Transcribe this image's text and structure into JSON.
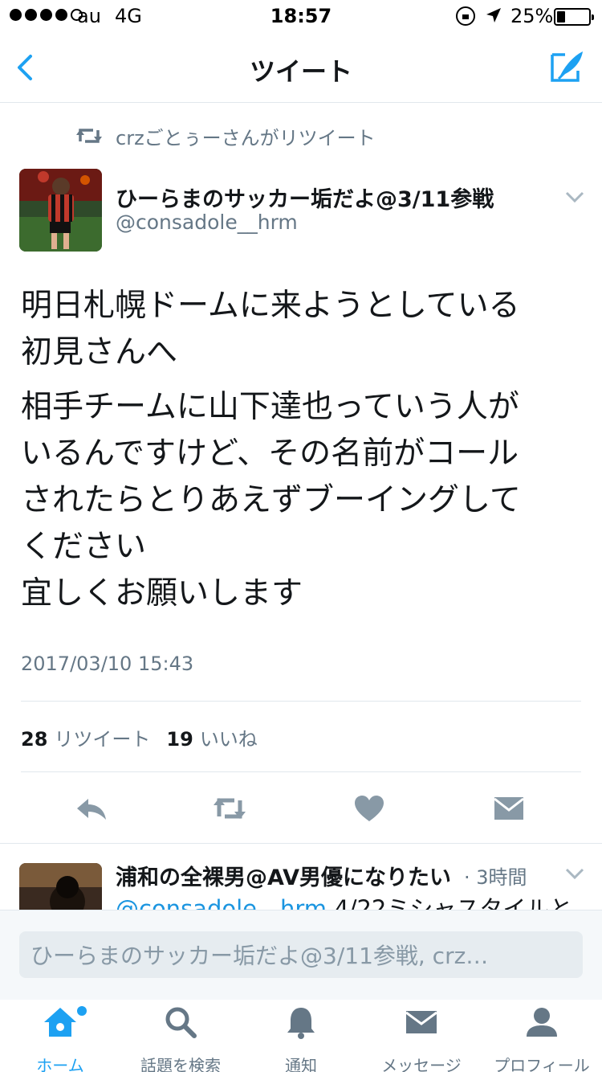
{
  "status_bar": {
    "carrier": "au",
    "network": "4G",
    "time": "18:57",
    "battery_percent": "25%",
    "battery_level": 0.25,
    "signal_bars": 4
  },
  "nav": {
    "title": "ツイート",
    "back_icon": "chevron-left-icon",
    "compose_icon": "compose-tweet-icon"
  },
  "retweet_context": {
    "text": "crzごとぅーさんがリツイート",
    "icon": "retweet-icon"
  },
  "tweet": {
    "author_name": "ひーらまのサッカー垢だよ@3/11参戦",
    "author_handle": "@consadole__hrm",
    "paragraph1": "明日札幌ドームに来ようとしている\n初見さんへ",
    "paragraph2": "相手チームに山下達也っていう人が\nいるんですけど、その名前がコール\nされたらとりあえずブーイングして\nください\n宜しくお願いします",
    "timestamp": "2017/03/10 15:43",
    "retweet_count": "28",
    "retweet_label": "リツイート",
    "like_count": "19",
    "like_label": "いいね"
  },
  "actions": [
    "reply-icon",
    "retweet-icon",
    "like-icon",
    "message-icon"
  ],
  "reply_preview": {
    "name": "浦和の全裸男@AV男優になりたい",
    "time": "· 3時間",
    "mention": "@consadole__hrm",
    "text": " 4/22ミシャスタイルと"
  },
  "compose": {
    "placeholder": "ひーらまのサッカー垢だよ@3/11参戦, crz…"
  },
  "tabs": [
    {
      "label": "ホーム",
      "icon": "home-icon",
      "active": true
    },
    {
      "label": "話題を検索",
      "icon": "search-icon",
      "active": false
    },
    {
      "label": "通知",
      "icon": "bell-icon",
      "active": false
    },
    {
      "label": "メッセージ",
      "icon": "envelope-icon",
      "active": false
    },
    {
      "label": "プロフィール",
      "icon": "person-icon",
      "active": false
    }
  ],
  "colors": {
    "accent": "#1da1f2",
    "secondary_text": "#657786",
    "icon_gray": "#8899a6",
    "divider": "#e1e8ed"
  }
}
